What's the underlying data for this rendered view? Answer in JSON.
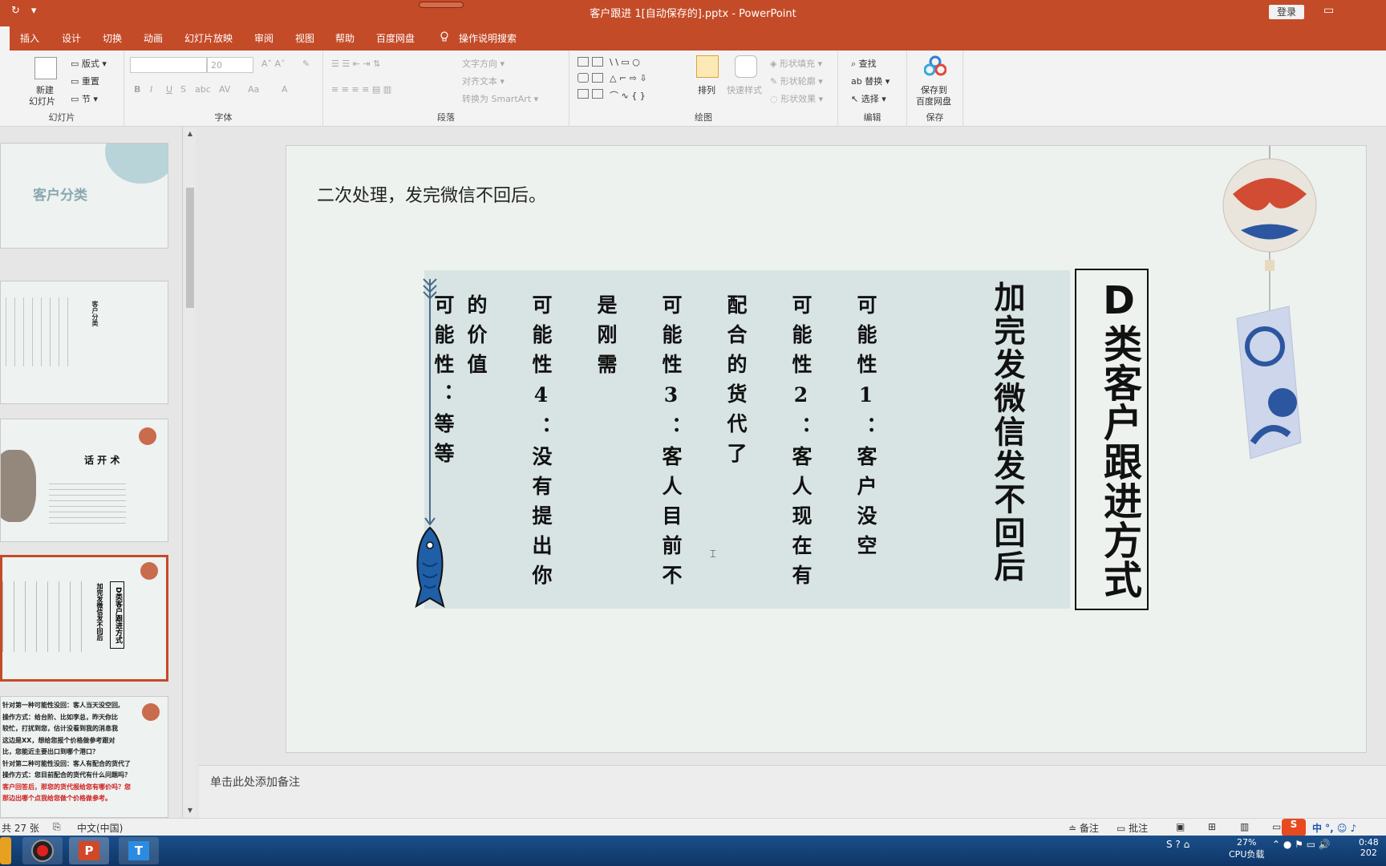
{
  "window": {
    "title": "客户跟进 1[自动保存的].pptx - PowerPoint",
    "login_label": "登录"
  },
  "tabs": [
    "插入",
    "设计",
    "切换",
    "动画",
    "幻灯片放映",
    "审阅",
    "视图",
    "帮助",
    "百度网盘"
  ],
  "tell_me": "操作说明搜索",
  "ribbon": {
    "slides_group": {
      "new_slide": "新建",
      "new_slide2": "幻灯片",
      "layout": "版式",
      "reset": "重置",
      "section": "节",
      "name": "幻灯片"
    },
    "font_group": {
      "size": "20",
      "name": "字体"
    },
    "paragraph_group": {
      "text_direction": "文字方向",
      "align_text": "对齐文本",
      "smartart": "转换为 SmartArt",
      "name": "段落"
    },
    "drawing_group": {
      "arrange": "排列",
      "quick_styles": "快速样式",
      "shape_fill": "形状填充",
      "shape_outline": "形状轮廓",
      "shape_effects": "形状效果",
      "name": "绘图"
    },
    "editing_group": {
      "find": "查找",
      "replace": "替换",
      "select": "选择",
      "name": "编辑"
    },
    "save_group": {
      "save_to": "保存到",
      "baidu": "百度网盘",
      "name": "保存"
    }
  },
  "thumbnails": {
    "t1_title": "客户分类",
    "t2_title": "客户分类",
    "t3_title": "话 开 术",
    "t4_title": "D类客户跟进方式",
    "t4_sub": "加完发微信发不回后",
    "t5_lines": [
      "针对第一种可能性没回：客人当天没空回,",
      "操作方式：给台阶、比如李总，昨天你比",
      "较忙，打扰到您，估计没看到我的消息我",
      "这边是XX，想给您报个价格做参考跟对",
      "比，您能近主要出口到哪个港口？",
      "针对第二种可能性没回：客人有配合的货代了",
      "操作方式：您目前配合的货代有什么问题吗？"
    ],
    "t5_red": [
      "客户回答后，那您的货代报给您有哪价吗？您",
      "那边出哪个点我给您做个价格做参考。"
    ]
  },
  "slide": {
    "subtitle": "二次处理，发完微信不回后。",
    "heading": "加完发微信发不回后",
    "title": "D类客户跟进方式",
    "columns": [
      "可能性1：客户没空",
      "可能性2：客人现在有",
      "配合的货代了",
      "可能性3：客人目前不",
      "是刚需",
      "可能性4：没有提出你",
      "的价值",
      "可能性：等等"
    ]
  },
  "notes_placeholder": "单击此处添加备注",
  "status": {
    "slide_count": "共 27 张",
    "language": "中文(中国)",
    "notes_btn": "备注",
    "comments_btn": "批注"
  },
  "taskbar": {
    "cpu_percent": "27%",
    "cpu_label": "CPU负载",
    "time": "0:48",
    "year": "202"
  },
  "colors": {
    "accent": "#c44b28",
    "slide_bg": "#eef2ef",
    "panel": "#d8e4e4",
    "fish_blue": "#1f5fa8"
  }
}
